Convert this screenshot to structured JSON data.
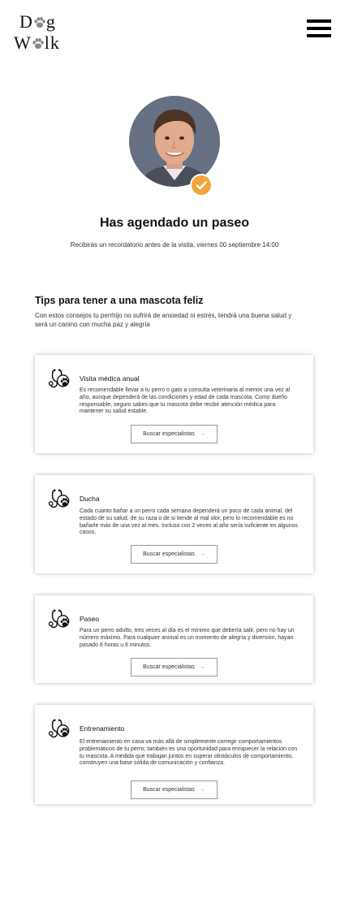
{
  "logo": {
    "row1_prefix": "D",
    "row1_suffix": "g",
    "row2_prefix": "W",
    "row2_suffix": "lk"
  },
  "header": {
    "menu_icon": "hamburger-icon"
  },
  "confirmation": {
    "check_icon": "checkmark-icon",
    "title": "Has agendado un paseo",
    "subtitle": "Recibirás un recordatorio antes de la visita, viernes 00 septiembre 14:00"
  },
  "tips": {
    "title": "Tips para tener a una mascota feliz",
    "description": "Con estos consejos tu perrhijo no sufrirá de ansiedad ni estrés, tendrá una buena salud y será un canino con mucha paz y alegría",
    "cards": [
      {
        "icon": "stethoscope-paw-icon",
        "title": "Visita médica anual",
        "text": "Es recomendable llevar a tu perro o gato a consulta veterinaria al menos una vez al año, aunque dependerá de las condiciones y edad de cada mascota. Como dueño responsable, seguro sabes que tu mascota debe recibir atención médica para mantener su salud estable.",
        "button": "Buscar especialistas"
      },
      {
        "icon": "stethoscope-paw-icon",
        "title": "Ducha",
        "text": "Cada cuanto bañar a un perro cada semana dependerá un poco de cada animal, del estado de su salud, de su raza o de si tiende al mal olor, pero lo recomendable es no bañarle más de una vez al mes. Incluso con 2 veces al año sería suficiente en algunos casos.",
        "button": "Buscar especialistas"
      },
      {
        "icon": "stethoscope-paw-icon",
        "title": "Paseo",
        "text": "Para un perro adulto, tres veces al día es el mínimo que debería salir, pero no hay un número máximo. Para cualquier animal es un momento de alegría y diversión, hayan pasado 8 horas u 8 minutos.",
        "button": "Buscar especialistas"
      },
      {
        "icon": "stethoscope-paw-icon",
        "title": "Entrenamiento",
        "text": "El entrenamiento en casa va más allá de simplemente corregir comportamientos problemáticos de tu perro; también es una oportunidad para enriquecer la relación con tu mascota. A medida que trabajan juntos en superar obstáculos de comportamiento, construyen una base sólida de comunicación y confianza.",
        "button": "Buscar especialistas"
      }
    ]
  },
  "colors": {
    "accent": "#f0a63a",
    "paw": "#888888",
    "card_shadow": "#cccccc"
  }
}
